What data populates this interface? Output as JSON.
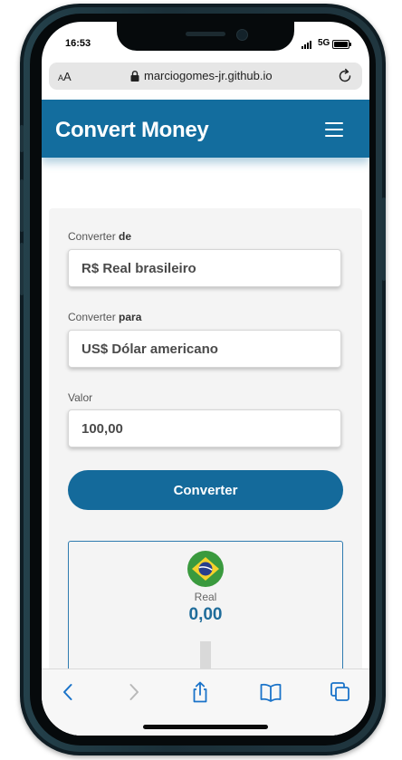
{
  "status_bar": {
    "time": "16:53",
    "network": "5G"
  },
  "browser": {
    "text_size_label": "AA",
    "url": "marciogomes-jr.github.io"
  },
  "app": {
    "title": "Convert Money",
    "colors": {
      "header": "#136d9e",
      "button": "#146a9b",
      "result_value": "#1f6c9a"
    }
  },
  "form": {
    "from_label": "Converter",
    "from_label_bold": "de",
    "from_value": "R$ Real brasileiro",
    "to_label": "Converter",
    "to_label_bold": "para",
    "to_value": "US$ Dólar americano",
    "amount_label": "Valor",
    "amount_value": "100,00",
    "convert_button": "Converter"
  },
  "result": {
    "currency_name": "Real",
    "value": "0,00",
    "flag": "brazil-flag"
  },
  "toolbar": {
    "icons": [
      "back-icon",
      "forward-icon",
      "share-icon",
      "bookmarks-icon",
      "tabs-icon"
    ]
  }
}
